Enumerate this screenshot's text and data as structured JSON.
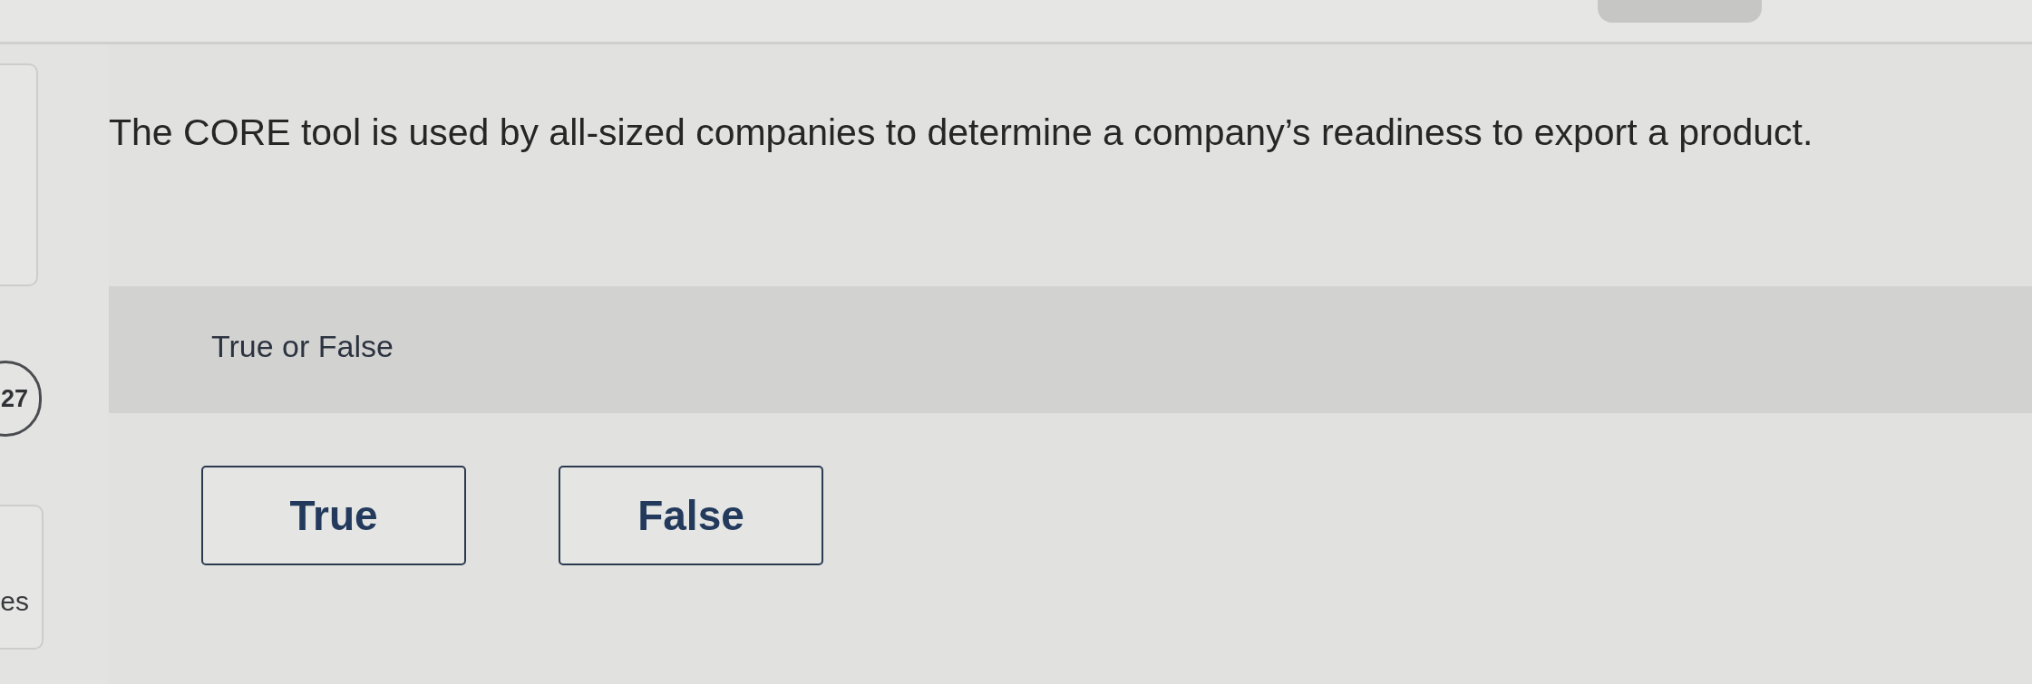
{
  "sidebar": {
    "question_number": "27",
    "card_label": "es"
  },
  "question": {
    "prompt": "The CORE tool is used by all-sized companies to determine a company’s readiness to export a product.",
    "answer_type": "True or False",
    "options": [
      {
        "label": "True",
        "selected": false
      },
      {
        "label": "False",
        "selected": false
      }
    ]
  }
}
